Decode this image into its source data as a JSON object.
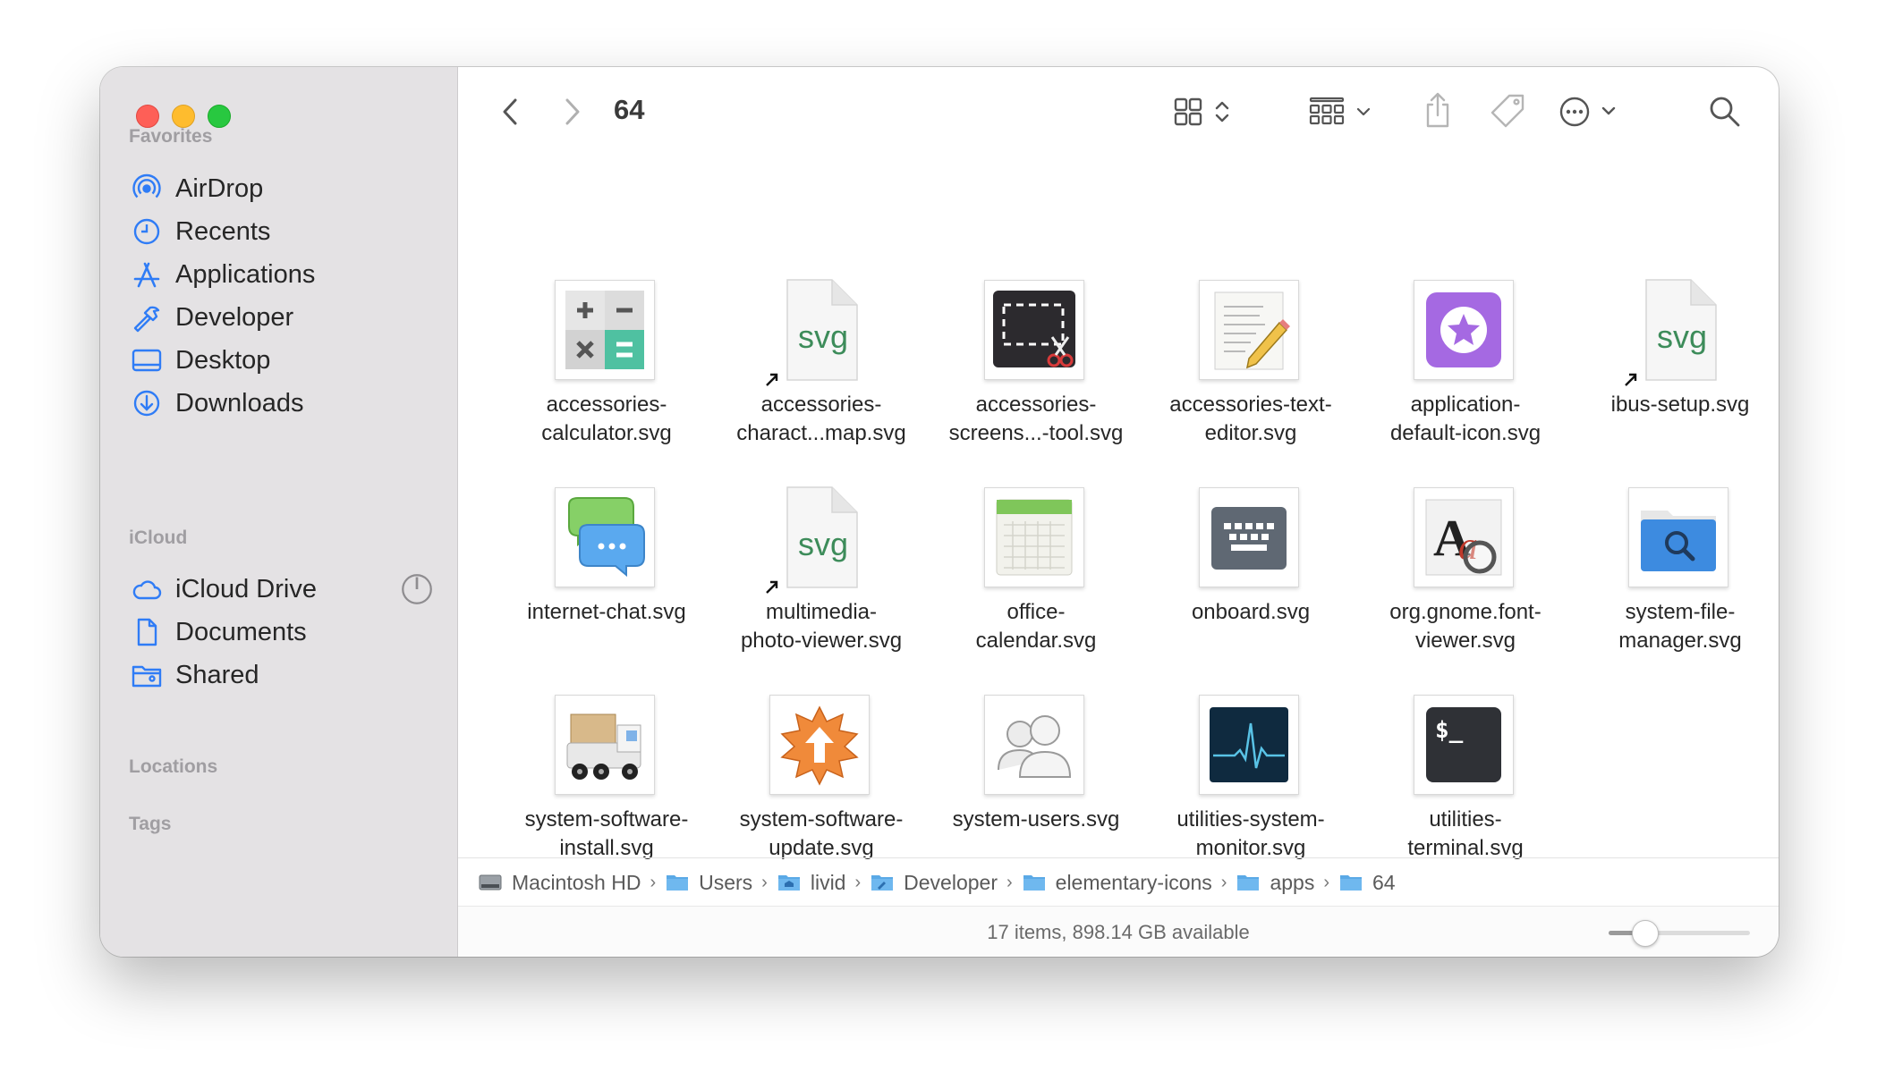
{
  "window": {
    "title": "64"
  },
  "sidebar": {
    "favorites_label": "Favorites",
    "favorites": [
      {
        "label": "AirDrop",
        "icon": "airdrop-icon"
      },
      {
        "label": "Recents",
        "icon": "clock-icon"
      },
      {
        "label": "Applications",
        "icon": "applications-icon"
      },
      {
        "label": "Developer",
        "icon": "hammer-icon"
      },
      {
        "label": "Desktop",
        "icon": "desktop-icon"
      },
      {
        "label": "Downloads",
        "icon": "download-icon"
      }
    ],
    "icloud_label": "iCloud",
    "icloud": [
      {
        "label": "iCloud Drive",
        "icon": "cloud-icon"
      },
      {
        "label": "Documents",
        "icon": "document-icon"
      },
      {
        "label": "Shared",
        "icon": "shared-folder-icon"
      }
    ],
    "locations_label": "Locations",
    "tags_label": "Tags"
  },
  "files": [
    {
      "line1": "accessories-",
      "line2": "calculator.svg",
      "icon": "calculator-icon"
    },
    {
      "line1": "accessories-",
      "line2": "charact...map.svg",
      "icon": "svg-file-icon",
      "alias": true
    },
    {
      "line1": "accessories-",
      "line2": "screens...-tool.svg",
      "icon": "screenshot-tool-icon"
    },
    {
      "line1": "accessories-text-",
      "line2": "editor.svg",
      "icon": "text-editor-icon"
    },
    {
      "line1": "application-",
      "line2": "default-icon.svg",
      "icon": "star-app-icon"
    },
    {
      "line1": "ibus-setup.svg",
      "line2": "",
      "icon": "svg-file-icon",
      "alias": true
    },
    {
      "line1": "internet-chat.svg",
      "line2": "",
      "icon": "chat-icon"
    },
    {
      "line1": "multimedia-",
      "line2": "photo-viewer.svg",
      "icon": "svg-file-icon",
      "alias": true
    },
    {
      "line1": "office-",
      "line2": "calendar.svg",
      "icon": "calendar-icon"
    },
    {
      "line1": "onboard.svg",
      "line2": "",
      "icon": "keyboard-icon"
    },
    {
      "line1": "org.gnome.font-",
      "line2": "viewer.svg",
      "icon": "font-viewer-icon"
    },
    {
      "line1": "system-file-",
      "line2": "manager.svg",
      "icon": "file-manager-icon"
    },
    {
      "line1": "system-software-",
      "line2": "install.svg",
      "icon": "software-install-icon"
    },
    {
      "line1": "system-software-",
      "line2": "update.svg",
      "icon": "software-update-icon"
    },
    {
      "line1": "system-users.svg",
      "line2": "",
      "icon": "users-icon"
    },
    {
      "line1": "utilities-system-",
      "line2": "monitor.svg",
      "icon": "system-monitor-icon"
    },
    {
      "line1": "utilities-",
      "line2": "terminal.svg",
      "icon": "terminal-icon"
    }
  ],
  "svg_badge": "svg",
  "terminal_prompt": "$_",
  "font_viewer_glyph": "A",
  "path": [
    {
      "label": "Macintosh HD",
      "icon": "hard-drive-icon"
    },
    {
      "label": "Users",
      "icon": "folder-icon"
    },
    {
      "label": "livid",
      "icon": "home-folder-icon"
    },
    {
      "label": "Developer",
      "icon": "folder-icon"
    },
    {
      "label": "elementary-icons",
      "icon": "folder-icon"
    },
    {
      "label": "apps",
      "icon": "folder-icon"
    },
    {
      "label": "64",
      "icon": "folder-icon"
    }
  ],
  "status": {
    "text": "17 items, 898.14 GB available",
    "zoom_fraction": 0.2
  },
  "colors": {
    "sidebar_bg": "#e4e2e4",
    "accent": "#2f7cf6",
    "folder_blue": "#5aa9e6"
  }
}
